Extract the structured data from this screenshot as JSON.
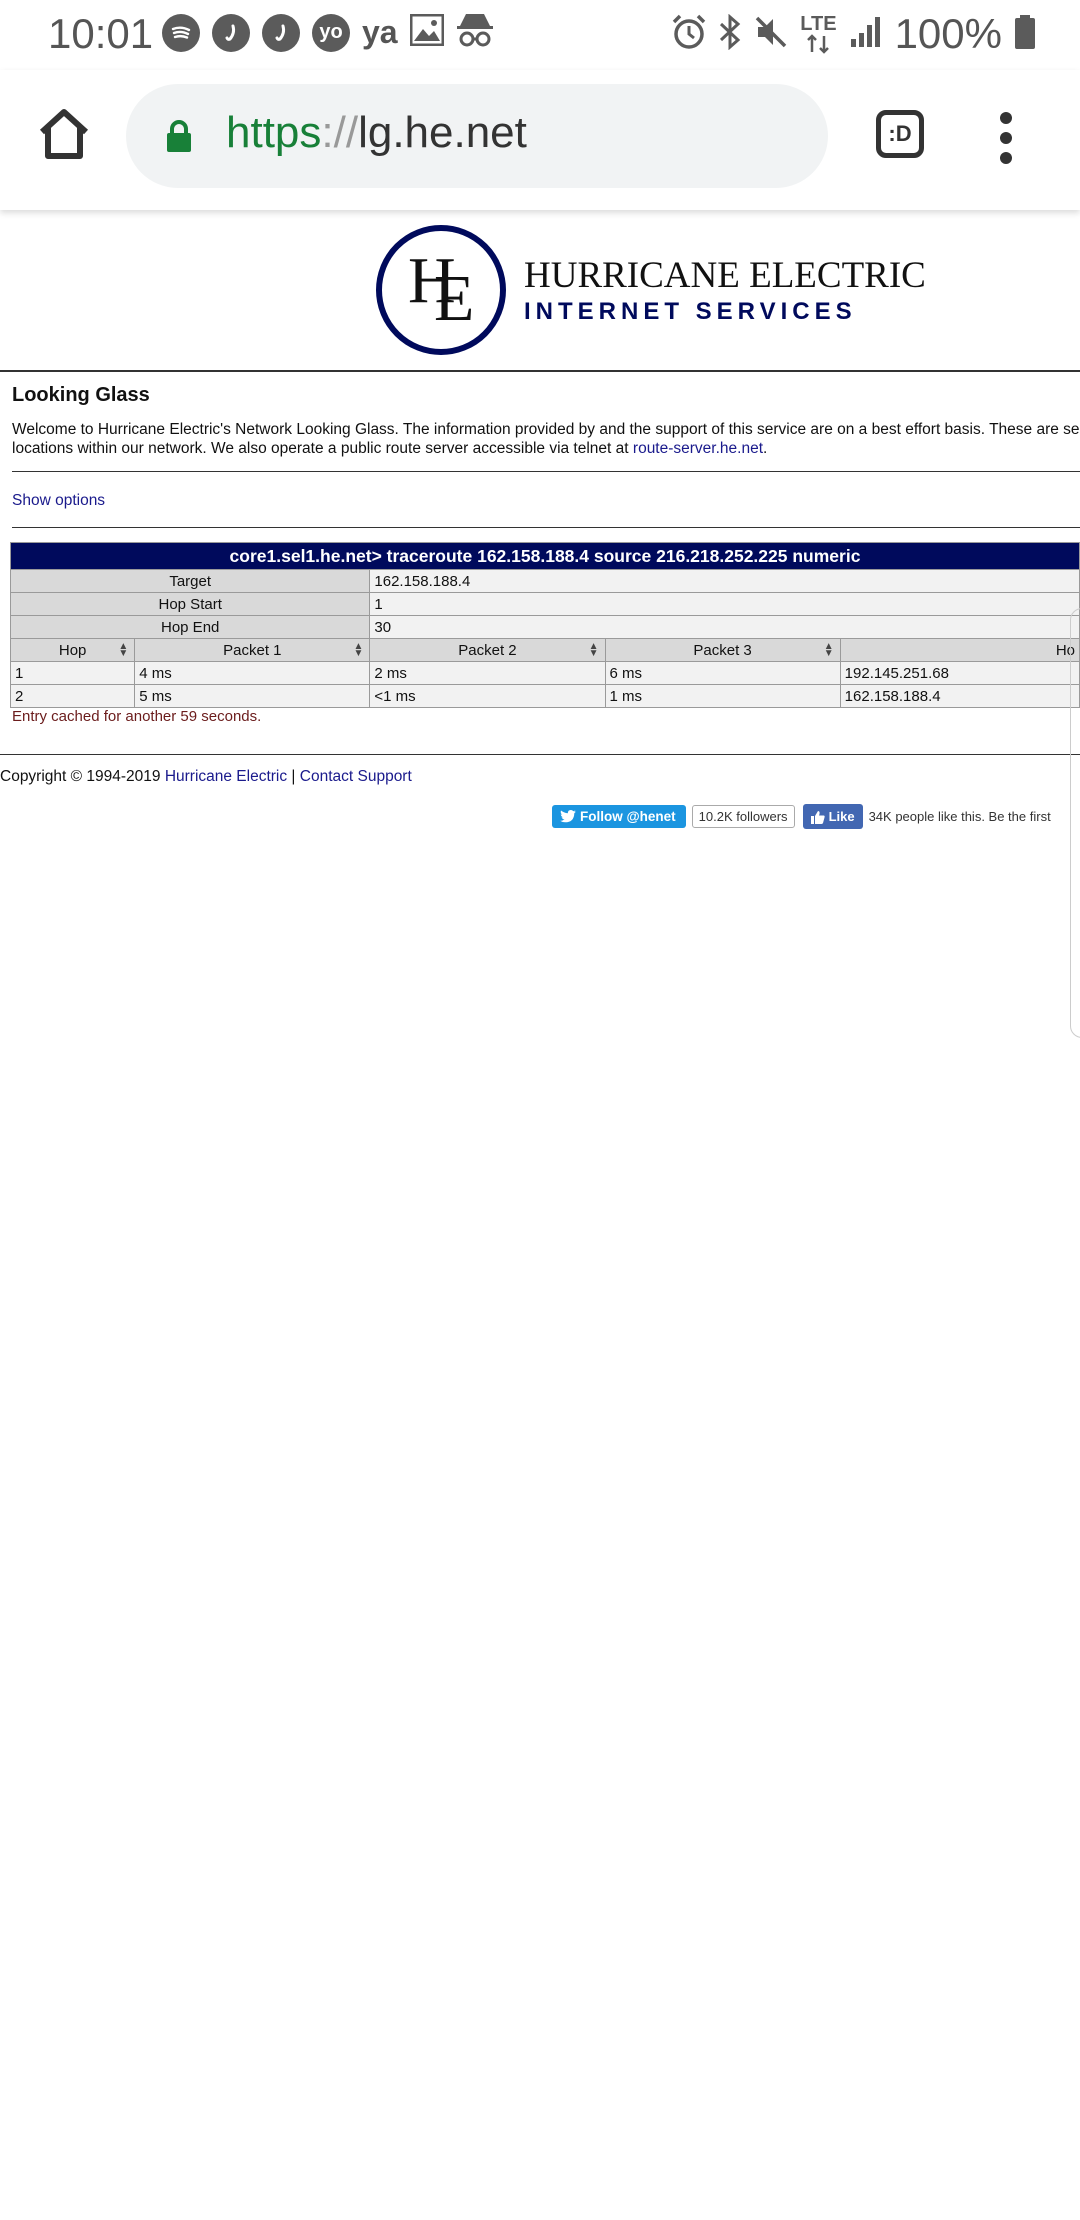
{
  "status_bar": {
    "time": "10:01",
    "left_icons": [
      "spotify-icon",
      "jiosaavn-icon",
      "jiosaavn-icon",
      "yo-icon",
      "ya-icon",
      "image-icon",
      "incognito-icon"
    ],
    "ya_text": "ya",
    "yo_text": "yo",
    "network": "LTE",
    "battery": "100%"
  },
  "browser": {
    "url_scheme": "https",
    "url_separator": "://",
    "url_host": "lg.he.net",
    "tab_label": ":D"
  },
  "logo": {
    "line1": "HURRICANE ELECTRIC",
    "line2": "INTERNET SERVICES",
    "monogram_h": "H",
    "monogram_e": "E",
    "color": "#000a5c"
  },
  "page": {
    "title": "Looking Glass",
    "welcome_line1": "Welcome to Hurricane Electric's Network Looking Glass. The information provided by and the support of this service are on a best effort basis. These are se",
    "welcome_line2_prefix": "locations within our network. We also operate a public route server accessible via telnet at ",
    "welcome_link": "route-server.he.net",
    "welcome_line2_suffix": ".",
    "show_options": "Show options"
  },
  "result": {
    "header": "core1.sel1.he.net> traceroute 162.158.188.4 source 216.218.252.225 numeric",
    "target_label": "Target",
    "target_value": "162.158.188.4",
    "hop_start_label": "Hop Start",
    "hop_start_value": "1",
    "hop_end_label": "Hop End",
    "hop_end_value": "30",
    "columns": [
      "Hop",
      "Packet 1",
      "Packet 2",
      "Packet 3",
      "Ho"
    ],
    "rows": [
      [
        "1",
        "4 ms",
        "2 ms",
        "6 ms",
        "192.145.251.68"
      ],
      [
        "2",
        "5 ms",
        "<1 ms",
        "1 ms",
        "162.158.188.4"
      ]
    ],
    "cached_note": "Entry cached for another 59 seconds."
  },
  "footer": {
    "copyright": "Copyright © 1994-2019 ",
    "he_link": "Hurricane Electric",
    "sep": " | ",
    "support_link": "Contact Support",
    "twitter_follow": "Follow @henet",
    "twitter_followers": "10.2K followers",
    "fb_like": "Like",
    "fb_text": "34K people like this. Be the first"
  }
}
